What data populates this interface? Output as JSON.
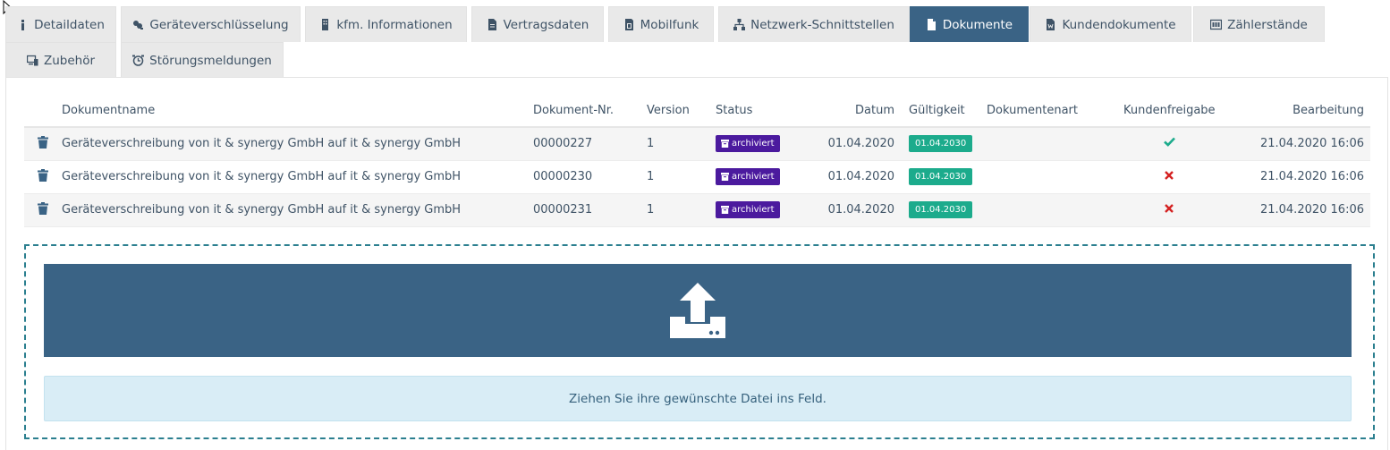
{
  "tabs": [
    {
      "label": "Detaildaten",
      "icon": "info-icon"
    },
    {
      "label": "Geräteverschlüsselung",
      "icon": "keys-icon"
    },
    {
      "label": "kfm. Informationen",
      "icon": "building-icon"
    },
    {
      "label": "Vertragsdaten",
      "icon": "file-icon"
    },
    {
      "label": "Mobilfunk",
      "icon": "sim-icon"
    },
    {
      "label": "Netzwerk-Schnittstellen",
      "icon": "network-icon"
    },
    {
      "label": "Dokumente",
      "icon": "document-icon",
      "active": true
    },
    {
      "label": "Kundendokumente",
      "icon": "word-file-icon"
    },
    {
      "label": "Zählerstände",
      "icon": "meter-icon"
    },
    {
      "label": "Zubehör",
      "icon": "devices-icon"
    },
    {
      "label": "Störungsmeldungen",
      "icon": "alarm-clock-icon"
    }
  ],
  "table": {
    "headers": {
      "name": "Dokumentname",
      "nr": "Dokument-Nr.",
      "version": "Version",
      "status": "Status",
      "datum": "Datum",
      "gueltigkeit": "Gültigkeit",
      "art": "Dokumentenart",
      "freigabe": "Kundenfreigabe",
      "bearbeitung": "Bearbeitung"
    },
    "rows": [
      {
        "name": "Geräteverschreibung von it & synergy GmbH auf it & synergy GmbH",
        "nr": "00000227",
        "version": "1",
        "status": "archiviert",
        "datum": "01.04.2020",
        "gueltigkeit": "01.04.2030",
        "art": "",
        "freigabe": "yes",
        "bearbeitung": "21.04.2020 16:06"
      },
      {
        "name": "Geräteverschreibung von it & synergy GmbH auf it & synergy GmbH",
        "nr": "00000230",
        "version": "1",
        "status": "archiviert",
        "datum": "01.04.2020",
        "gueltigkeit": "01.04.2030",
        "art": "",
        "freigabe": "no",
        "bearbeitung": "21.04.2020 16:06"
      },
      {
        "name": "Geräteverschreibung von it & synergy GmbH auf it & synergy GmbH",
        "nr": "00000231",
        "version": "1",
        "status": "archiviert",
        "datum": "01.04.2020",
        "gueltigkeit": "01.04.2030",
        "art": "",
        "freigabe": "no",
        "bearbeitung": "21.04.2020 16:06"
      }
    ]
  },
  "dropzone": {
    "hint": "Ziehen Sie ihre gewünschte Datei ins Feld.",
    "icon": "upload-icon"
  },
  "colors": {
    "accent": "#3a6385",
    "archived": "#4b1a9e",
    "validity": "#1cab8c",
    "check": "#1cab8c",
    "cross": "#d42020"
  }
}
